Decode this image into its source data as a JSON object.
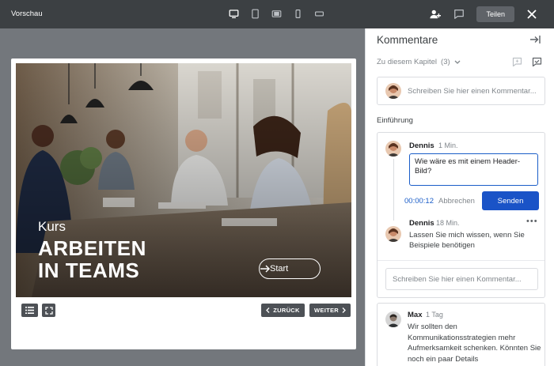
{
  "topbar": {
    "title": "Vorschau",
    "devices": [
      {
        "name": "desktop-icon",
        "active": true
      },
      {
        "name": "tablet-portrait-icon",
        "active": false
      },
      {
        "name": "tablet-landscape-icon",
        "active": false
      },
      {
        "name": "phone-portrait-icon",
        "active": false
      },
      {
        "name": "phone-landscape-icon",
        "active": false
      }
    ],
    "share_label": "Teilen",
    "icons": {
      "add_user": "add-user-icon",
      "comment": "comment-icon",
      "close": "close-icon"
    }
  },
  "slide": {
    "kurs_label": "Kurs",
    "heading": "ARBEITEN\nIN TEAMS",
    "start_label": "Start",
    "back_label": "ZURÜCK",
    "next_label": "WEITER"
  },
  "panel": {
    "title": "Kommentare",
    "chapter_label": "Zu diesem Kapitel",
    "chapter_count": "(3)",
    "new_comment_placeholder": "Schreiben Sie hier einen Kommentar...",
    "section_label": "Einführung",
    "thread": {
      "author": "Dennis",
      "time": "1 Min.",
      "reply_text": "Wie wäre es mit einem Header-Bild?",
      "timer": "00:00:12",
      "cancel_label": "Abbrechen",
      "send_label": "Senden",
      "reply_author": "Dennis",
      "reply_time": "18 Min.",
      "reply_body": "Lassen Sie mich wissen, wenn Sie Beispiele benötigen",
      "reply_placeholder": "Schreiben Sie hier einen Kommentar..."
    },
    "comment2": {
      "author": "Max",
      "time": "1 Tag",
      "body": "Wir sollten den Kommunikationsstrategien mehr Aufmerksamkeit schenken. Könnten Sie noch ein paar Details"
    }
  },
  "colors": {
    "topbar": "#3c4043",
    "preview_bg": "#73777c",
    "accent": "#1a53c7",
    "nav_button": "#4d5156"
  }
}
